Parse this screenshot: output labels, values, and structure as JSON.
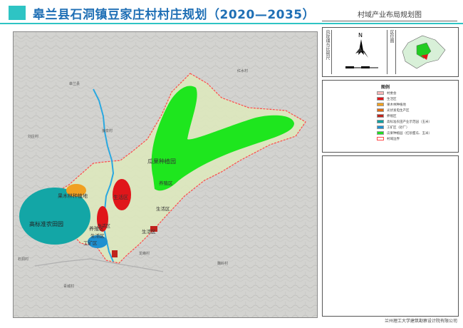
{
  "title": "皋兰县石洞镇豆家庄村村庄规划（2020—2035）",
  "subtitle": "村域产业布局规划图",
  "side_labels": {
    "scale": "风玫瑰与比例尺",
    "location": "区位图"
  },
  "north": "N",
  "legend": {
    "title": "图例",
    "items": [
      {
        "label": "村委会",
        "color": "#f4b6b6"
      },
      {
        "label": "生活区",
        "color": "#e0161a"
      },
      {
        "label": "果木林种植地",
        "color": "#f0a020"
      },
      {
        "label": "光伏发电生产区",
        "color": "#e06a10"
      },
      {
        "label": "养殖区",
        "color": "#c0241c"
      },
      {
        "label": "高标准农田产业示范园（玉米）",
        "color": "#0aa0a0"
      },
      {
        "label": "工矿区（砂厂）",
        "color": "#1e90d0"
      },
      {
        "label": "瓜果种植园（红砂甜瓜、玉米）",
        "color": "#22dd22"
      },
      {
        "label": "村域边界",
        "color": "#ffffff"
      }
    ]
  },
  "map_labels": {
    "zone_green": "瓜果种植园",
    "zone_teal": "高标准农田园",
    "zone_orange": "果木林种植地",
    "zone_red_north": "生活区",
    "zone_red_mid": "生活区",
    "zone_yangzhi": "养殖区",
    "zone_gongkuang": "工矿区",
    "zone_shengtai": "生活区",
    "zone_east1": "养殖区",
    "zone_east2": "生活区",
    "zone_south": "生活区"
  },
  "place_names": [
    "皋兰县",
    "狼泉村",
    "刘庄村",
    "红水村",
    "石洞村",
    "魏岭村",
    "龙峰村",
    "青城村"
  ],
  "footer": "兰州理工大学建筑勘察设计院有限公司"
}
